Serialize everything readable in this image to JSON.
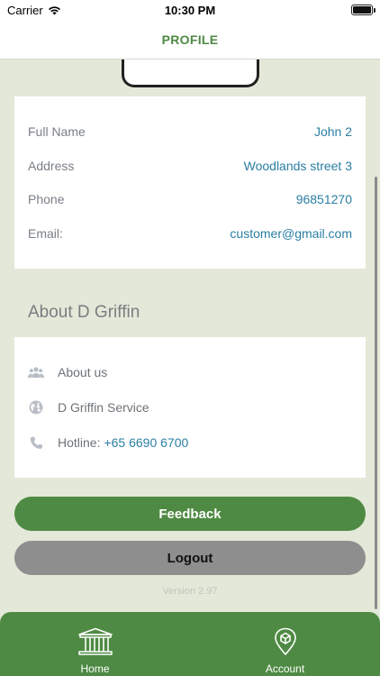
{
  "status_bar": {
    "carrier": "Carrier",
    "time": "10:30 PM"
  },
  "nav": {
    "title": "PROFILE"
  },
  "info": [
    {
      "label": "Full Name",
      "value": "John 2"
    },
    {
      "label": "Address",
      "value": "Woodlands street 3"
    },
    {
      "label": "Phone",
      "value": "96851270"
    },
    {
      "label": "Email:",
      "value": "customer@gmail.com"
    }
  ],
  "about": {
    "title": "About D Griffin",
    "about_us": "About us",
    "service": "D Griffin Service",
    "hotline_label": "Hotline:",
    "hotline_number": "+65 6690 6700"
  },
  "buttons": {
    "feedback": "Feedback",
    "logout": "Logout"
  },
  "version": "Version 2.97",
  "tabs": [
    {
      "label": "Home",
      "icon": "building-icon"
    },
    {
      "label": "Account",
      "icon": "location-pin-icon"
    }
  ],
  "colors": {
    "brand": "#4e8a43",
    "link": "#2a7ea3",
    "background": "#e3e8d8"
  }
}
